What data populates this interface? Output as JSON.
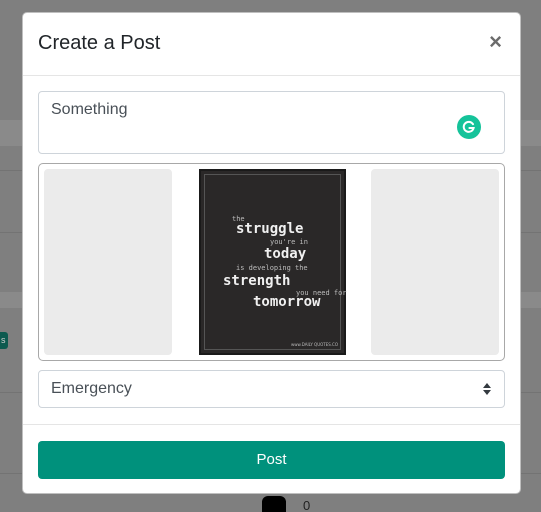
{
  "modal": {
    "title": "Create a Post",
    "close_label": "×"
  },
  "post_form": {
    "text_value": "Something",
    "category_selected": "Emergency",
    "submit_label": "Post"
  },
  "image_preview": {
    "quote_lines": [
      "the",
      "struggle",
      "you're in",
      "today",
      "is developing the",
      "strength",
      "you need for",
      "tomorrow"
    ],
    "credit": "www.DAILY QUOTES.CO"
  },
  "background": {
    "badge_text": "s",
    "counter_value": "0"
  },
  "colors": {
    "accent": "#00917c",
    "grammarly": "#15c39a"
  },
  "icons": {
    "close": "close-icon",
    "grammarly": "grammarly-icon",
    "select": "select-arrows-icon"
  }
}
